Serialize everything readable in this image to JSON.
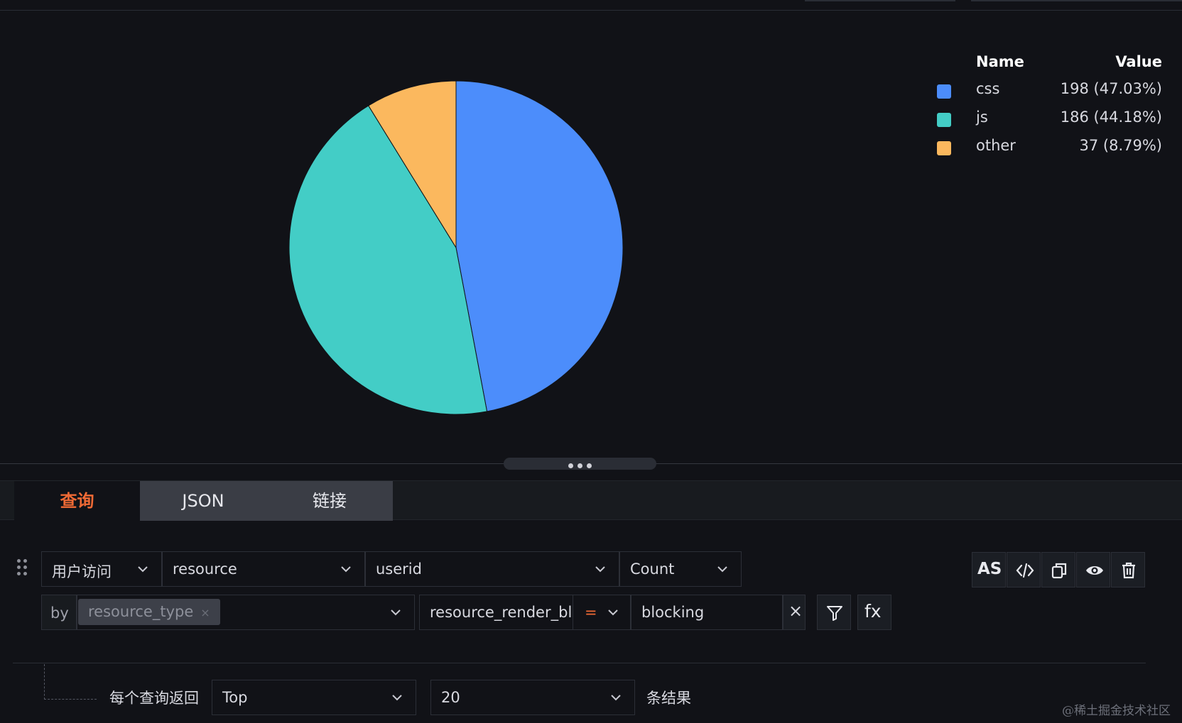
{
  "chart_data": {
    "type": "pie",
    "slices": [
      {
        "name": "css",
        "value": 198,
        "percent": "47.03%",
        "color": "#4c8dfb"
      },
      {
        "name": "js",
        "value": 186,
        "percent": "44.18%",
        "color": "#43cdc6"
      },
      {
        "name": "other",
        "value": 37,
        "percent": "8.79%",
        "color": "#fbb85e"
      }
    ],
    "legend": {
      "placement": "top-right",
      "name_header": "Name",
      "value_header": "Value",
      "rows": [
        {
          "label": "css",
          "display": "198 (47.03%)"
        },
        {
          "label": "js",
          "display": "186 (44.18%)"
        },
        {
          "label": "other",
          "display": "37 (8.79%)"
        }
      ]
    }
  },
  "tabs": {
    "query": "查询",
    "json": "JSON",
    "link": "链接"
  },
  "query_row": {
    "source": "用户访问",
    "measurement": "resource",
    "field": "userid",
    "aggregation": "Count",
    "as_button": "AS"
  },
  "group_row": {
    "by_label": "by",
    "group_tag": "resource_type",
    "tag_close": "×",
    "filter_key": "resource_render_bl",
    "filter_operator": "=",
    "filter_value": "blocking",
    "clear_glyph": "×",
    "fx_button": "fx"
  },
  "limit_row": {
    "prefix": "每个查询返回",
    "order": "Top",
    "count": "20",
    "suffix": "条结果"
  },
  "watermark": "@稀土掘金技术社区",
  "icons": {
    "chevron": "chevron-down-icon",
    "code": "code-icon",
    "copy": "copy-icon",
    "eye": "eye-icon",
    "trash": "trash-icon",
    "filter": "filter-icon",
    "drag": "drag-handle-icon"
  }
}
